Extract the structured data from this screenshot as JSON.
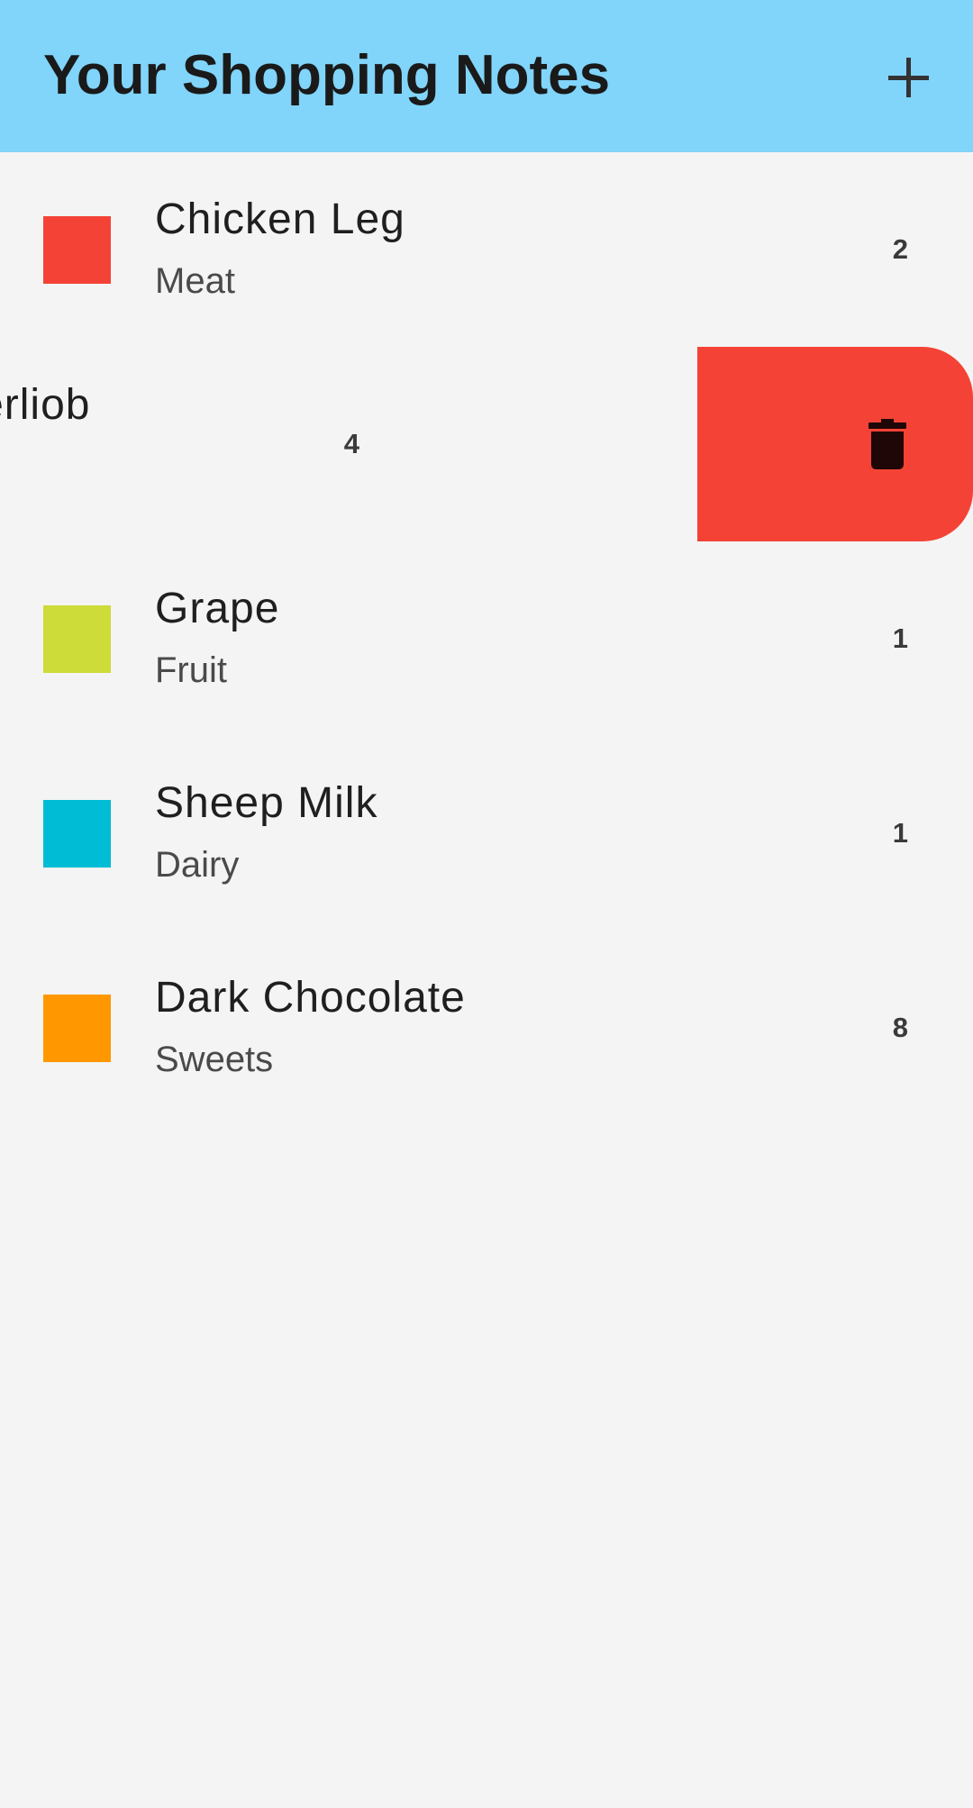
{
  "app_bar": {
    "title": "Your Shopping Notes",
    "add_icon": "plus-icon",
    "background": "#81d4fa"
  },
  "items": [
    {
      "name": "Chicken Leg",
      "category": "Meat",
      "quantity": "2",
      "color": "#f44336"
    },
    {
      "name": "Tenderliob",
      "category": "",
      "quantity": "4",
      "color": "#f44336",
      "swiped": true,
      "action_icon": "trash-icon",
      "action_color": "#f44336"
    },
    {
      "name": "Grape",
      "category": "Fruit",
      "quantity": "1",
      "color": "#cddc39"
    },
    {
      "name": "Sheep Milk",
      "category": "Dairy",
      "quantity": "1",
      "color": "#00bcd4"
    },
    {
      "name": "Dark Chocolate",
      "category": "Sweets",
      "quantity": "8",
      "color": "#ff9800"
    }
  ]
}
